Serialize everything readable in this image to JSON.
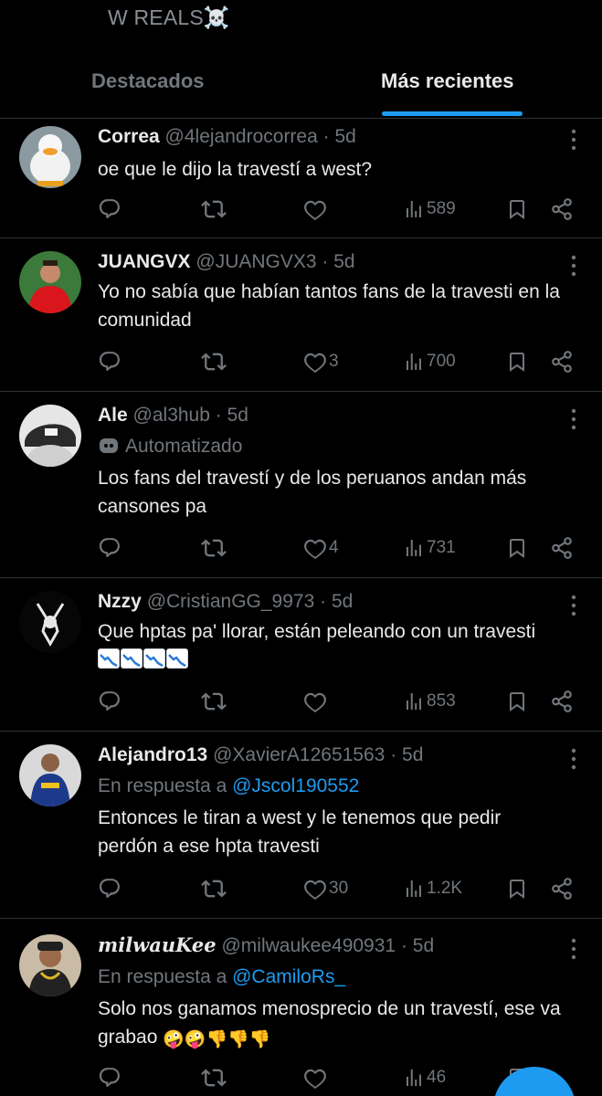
{
  "header": {
    "title": "W REALS☠️"
  },
  "tabs": [
    {
      "label": "Destacados",
      "active": false
    },
    {
      "label": "Más recientes",
      "active": true
    }
  ],
  "accent_color": "#1d9bf0",
  "tweets": [
    {
      "name": "Correa",
      "handle": "@4lejandrocorrea",
      "time": "· 5d",
      "text": "oe que le dijo la travestí a west?",
      "likes": "",
      "views": "589"
    },
    {
      "name": "JUANGVX",
      "handle": "@JUANGVX3",
      "time": "· 5d",
      "text": "Yo no sabía que habían tantos fans de la travesti en la comunidad",
      "likes": "3",
      "views": "700"
    },
    {
      "name": "Ale",
      "handle": "@al3hub",
      "time": "· 5d",
      "automated": "Automatizado",
      "text": "Los fans del travestí y de los peruanos andan más cansones pa",
      "likes": "4",
      "views": "731"
    },
    {
      "name": "Nzzy",
      "handle": "@CristianGG_9973",
      "time": "· 5d",
      "text": "Que hptas pa' llorar, están peleando con un travesti",
      "emoji": "chart-decreasing ×4",
      "likes": "",
      "views": "853"
    },
    {
      "name": "Alejandro13",
      "handle": "@XavierA12651563",
      "time": "· 5d",
      "reply_prefix": "En respuesta a",
      "reply_to": "@Jscol190552",
      "text": "Entonces le tiran a west y le tenemos que pedir perdón a ese hpta travesti",
      "likes": "30",
      "views": "1.2K"
    },
    {
      "name": "milwauKee",
      "handle": "@milwaukee490931",
      "time": "· 5d",
      "reply_prefix": "En respuesta a",
      "reply_to": "@CamiloRs_",
      "text": "Solo nos ganamos menosprecio de un travestí, ese va grabao",
      "emoji_tail": "🤪🤪👎👎👎",
      "likes": "",
      "views": "46"
    }
  ]
}
